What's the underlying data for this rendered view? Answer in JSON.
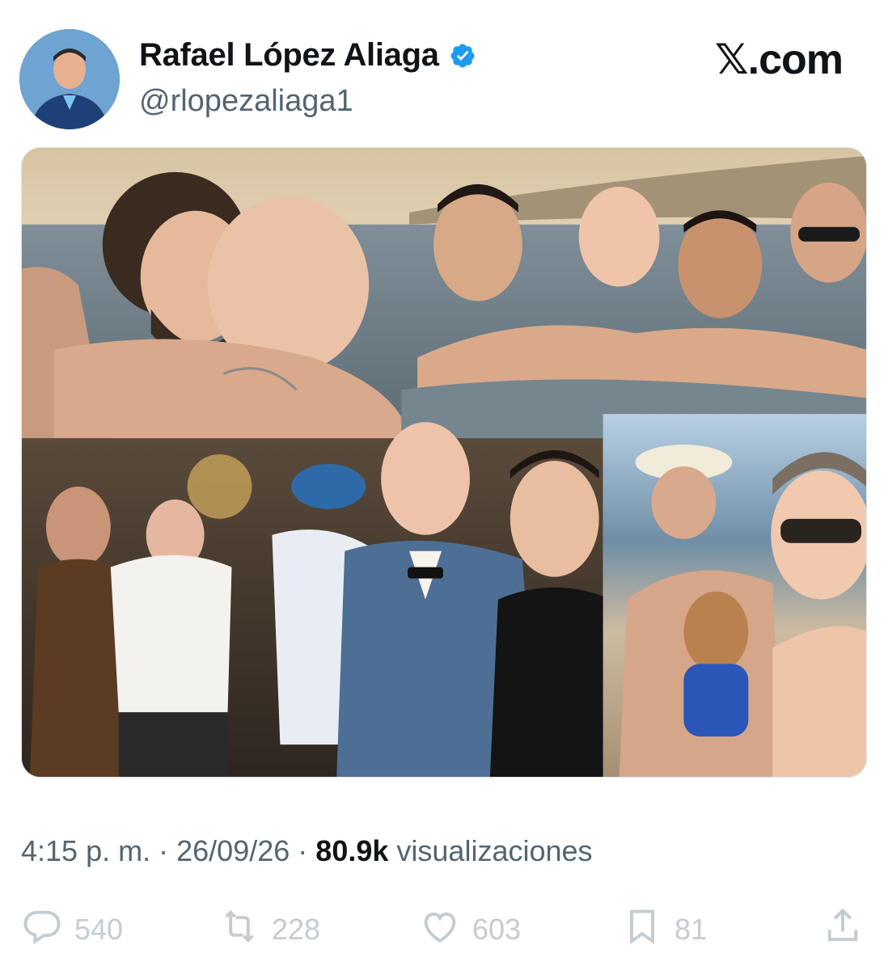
{
  "author": {
    "name": "Rafael López Aliaga",
    "handle": "@rlopezaliaga1",
    "verified": true
  },
  "brand": "𝕏.com",
  "media": {
    "type": "photo-collage"
  },
  "meta": {
    "time": "4:15 p. m.",
    "separator": "·",
    "date": "26/09/26",
    "views_count": "80.9k",
    "views_label": "visualizaciones"
  },
  "actions": {
    "replies": "540",
    "retweets": "228",
    "likes": "603",
    "bookmarks": "81"
  },
  "colors": {
    "verified_blue": "#1d9bf0",
    "secondary_text": "#536471",
    "icon_gray": "#8b98a5"
  }
}
